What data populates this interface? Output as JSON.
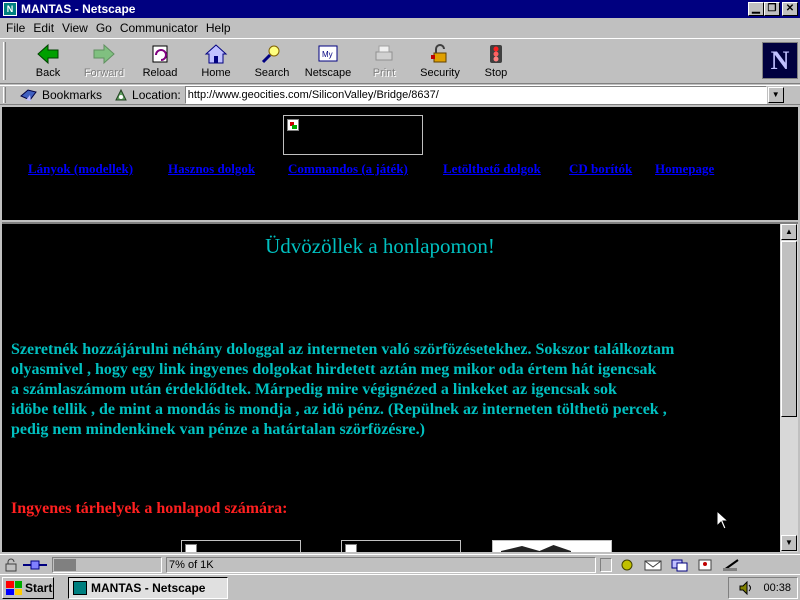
{
  "window": {
    "title": "MANTAS - Netscape"
  },
  "menu": [
    "File",
    "Edit",
    "View",
    "Go",
    "Communicator",
    "Help"
  ],
  "toolbar": {
    "buttons": [
      {
        "label": "Back",
        "icon": "back-arrow-icon",
        "enabled": true
      },
      {
        "label": "Forward",
        "icon": "forward-arrow-icon",
        "enabled": false
      },
      {
        "label": "Reload",
        "icon": "reload-icon",
        "enabled": true
      },
      {
        "label": "Home",
        "icon": "home-icon",
        "enabled": true
      },
      {
        "label": "Search",
        "icon": "search-icon",
        "enabled": true
      },
      {
        "label": "Netscape",
        "icon": "netscape-icon",
        "enabled": true
      },
      {
        "label": "Print",
        "icon": "printer-icon",
        "enabled": false
      },
      {
        "label": "Security",
        "icon": "padlock-icon",
        "enabled": true
      },
      {
        "label": "Stop",
        "icon": "stop-icon",
        "enabled": true
      }
    ],
    "logo": "N"
  },
  "location": {
    "bookmarks_label": "Bookmarks",
    "location_label": "Location:",
    "url": "http://www.geocities.com/SiliconValley/Bridge/8637/"
  },
  "top_frame": {
    "nav_links": [
      "Lányok (modellek)",
      "Hasznos dolgok",
      "Commandos (a játék)",
      "Letölthető dolgok",
      "CD borítók",
      "Homepage"
    ]
  },
  "main": {
    "welcome": "Üdvözöllek a honlapomon!",
    "paragraph_lines": [
      "Szeretnék hozzájárulni néhány dologgal az interneten való szörfözésetekhez. Sokszor találkoztam",
      "olyasmivel , hogy egy link ingyenes dolgokat hirdetett aztán meg mikor oda értem hát igencsak",
      "a számlaszámom után érdeklődtek. Márpedig mire végignézed a linkeket az igencsak sok",
      "idöbe tellik , de mint a mondás is mondja , az idö pénz. (Repülnek az interneten tölthetö percek ,",
      "pedig nem mindenkinek van pénze a határtalan szörfözésre.)"
    ],
    "subheading": "Ingyenes tárhelyek a honlapod számára:"
  },
  "colors": {
    "title_bar": "#000080",
    "page_bg": "#000000",
    "text_cyan": "#00c0c0",
    "link_blue": "#0000ff",
    "heading_red": "#ff2020"
  },
  "status": {
    "text": "7% of 1K",
    "progress_percent": 7
  },
  "taskbar": {
    "start_label": "Start",
    "task_label": "MANTAS - Netscape",
    "clock": "00:38"
  }
}
